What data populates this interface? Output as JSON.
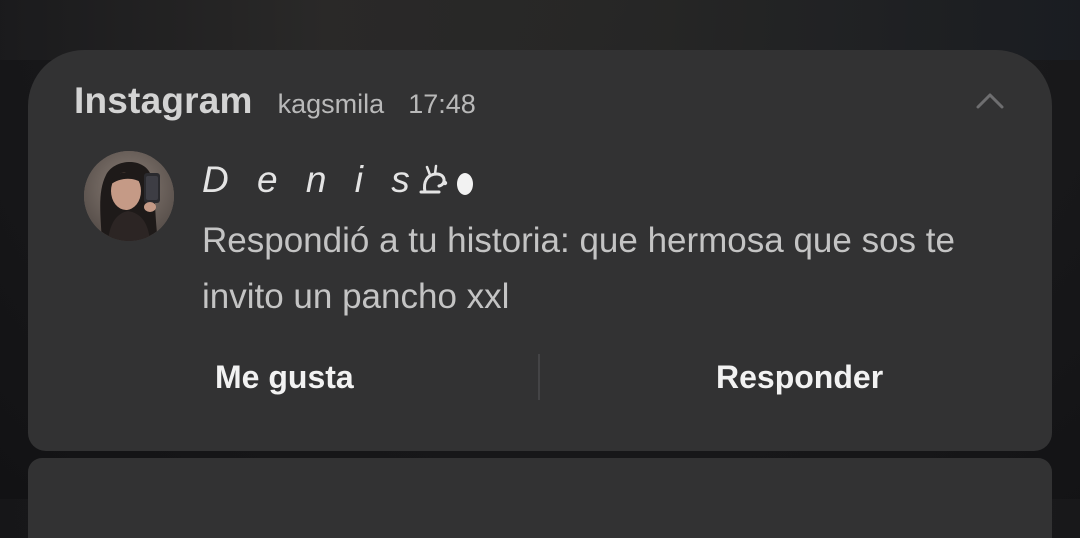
{
  "notification": {
    "app_name": "Instagram",
    "account": "kagsmila",
    "time": "17:48",
    "collapse_icon": "chevron-up-icon",
    "sender_name": "D e n i s",
    "sender_emoji": "snail-emoji",
    "message": "Respondió a tu historia: que hermosa que sos te invito un pancho xxl",
    "actions": {
      "like_label": "Me gusta",
      "reply_label": "Responder"
    }
  },
  "colors": {
    "card_background": "#323233",
    "primary_text": "#e4e4e4",
    "secondary_text": "#b9b9b9",
    "button_text": "#f2f2f2"
  }
}
